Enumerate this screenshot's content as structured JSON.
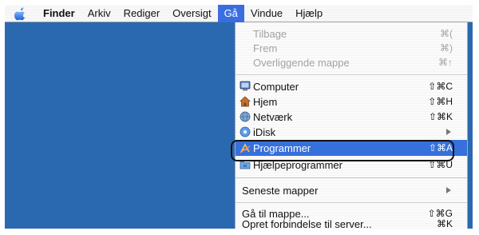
{
  "menubar": {
    "apple_icon": "apple-icon",
    "menus": [
      {
        "label": "Finder",
        "bold": true
      },
      {
        "label": "Arkiv"
      },
      {
        "label": "Rediger"
      },
      {
        "label": "Oversigt"
      },
      {
        "label": "Gå",
        "open": true
      },
      {
        "label": "Vindue"
      },
      {
        "label": "Hjælp"
      }
    ]
  },
  "dropdown": {
    "groups": [
      {
        "items": [
          {
            "label": "Tilbage",
            "shortcut": "⌘(",
            "disabled": true
          },
          {
            "label": "Frem",
            "shortcut": "⌘)",
            "disabled": true
          },
          {
            "label": "Overliggende mappe",
            "shortcut": "⌘↑",
            "disabled": true
          }
        ]
      },
      {
        "items": [
          {
            "label": "Computer",
            "shortcut": "⇧⌘C",
            "icon": "computer-icon"
          },
          {
            "label": "Hjem",
            "shortcut": "⇧⌘H",
            "icon": "home-icon"
          },
          {
            "label": "Netværk",
            "shortcut": "⇧⌘K",
            "icon": "network-icon"
          },
          {
            "label": "iDisk",
            "submenu": true,
            "icon": "idisk-icon"
          },
          {
            "label": "Programmer",
            "shortcut": "⇧⌘A",
            "icon": "applications-icon",
            "selected": true
          },
          {
            "label": "Hjælpeprogrammer",
            "shortcut": "⇧⌘U",
            "icon": "utilities-icon"
          }
        ]
      },
      {
        "items": [
          {
            "label": "Seneste mapper",
            "submenu": true
          }
        ]
      },
      {
        "items": [
          {
            "label": "Gå til mappe...",
            "shortcut": "⇧⌘G"
          },
          {
            "label": "Opret forbindelse til server...",
            "shortcut": "⌘K"
          }
        ]
      }
    ]
  },
  "colors": {
    "desktop": "#2a69b0",
    "selection": "#3670dc",
    "disabled_text": "#a3a3a3"
  }
}
